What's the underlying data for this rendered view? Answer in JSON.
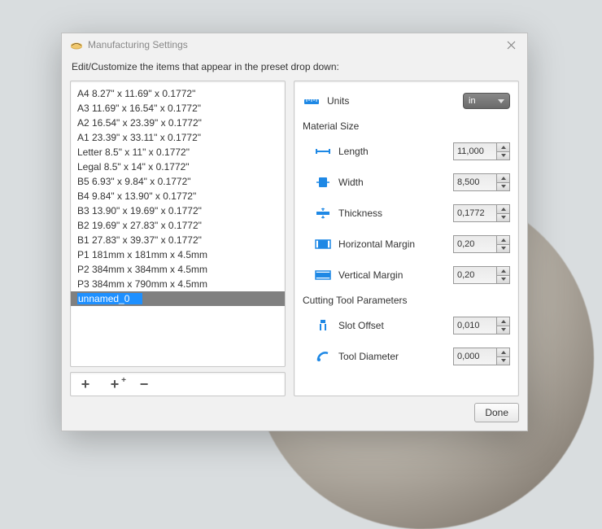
{
  "dialog": {
    "title": "Manufacturing Settings",
    "description": "Edit/Customize the items that appear in the preset drop down:"
  },
  "presets": [
    "A4 8.27\" x 11.69\" x 0.1772\"",
    "A3 11.69\" x 16.54\" x 0.1772\"",
    "A2 16.54\" x 23.39\" x 0.1772\"",
    "A1 23.39\" x 33.11\" x 0.1772\"",
    "Letter 8.5\" x 11\" x 0.1772\"",
    "Legal 8.5\" x 14\" x 0.1772\"",
    "B5 6.93\" x 9.84\" x 0.1772\"",
    "B4 9.84\" x 13.90\" x 0.1772\"",
    "B3 13.90\" x 19.69\" x 0.1772\"",
    "B2 19.69\" x 27.83\" x 0.1772\"",
    "B1 27.83\" x 39.37\" x 0.1772\"",
    "P1 181mm x 181mm x 4.5mm",
    "P2 384mm x 384mm x 4.5mm",
    "P3 384mm x 790mm x 4.5mm"
  ],
  "editing_preset": "unnamed_0",
  "properties": {
    "units": {
      "label": "Units",
      "value": "in"
    },
    "material_size_heading": "Material Size",
    "length": {
      "label": "Length",
      "value": "11,000"
    },
    "width": {
      "label": "Width",
      "value": "8,500"
    },
    "thickness": {
      "label": "Thickness",
      "value": "0,1772"
    },
    "hmargin": {
      "label": "Horizontal Margin",
      "value": "0,20"
    },
    "vmargin": {
      "label": "Vertical Margin",
      "value": "0,20"
    },
    "cutting_heading": "Cutting Tool Parameters",
    "slot_offset": {
      "label": "Slot Offset",
      "value": "0,010"
    },
    "tool_diameter": {
      "label": "Tool Diameter",
      "value": "0,000"
    }
  },
  "buttons": {
    "done": "Done"
  }
}
